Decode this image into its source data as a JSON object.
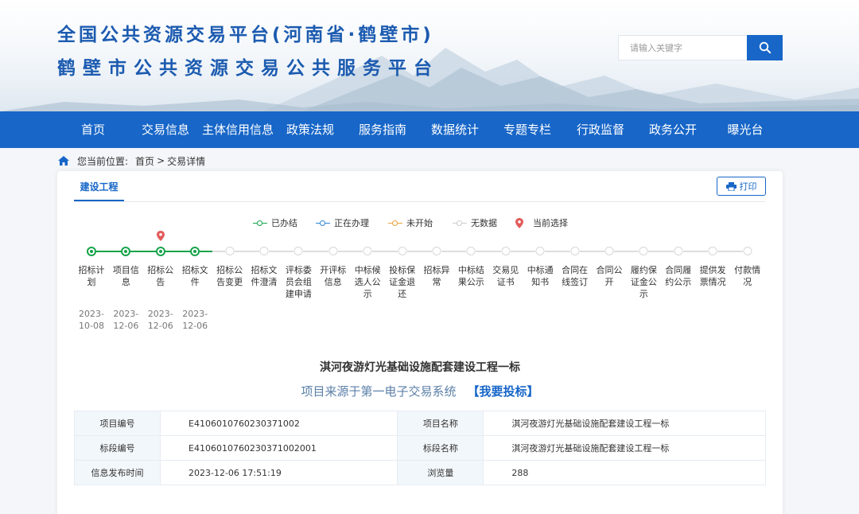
{
  "header": {
    "title_line1": "全国公共资源交易平台(河南省·鹤壁市)",
    "title_line2": "鹤壁市公共资源交易公共服务平台",
    "search_placeholder": "请输入关键字",
    "search_icon": "search-icon"
  },
  "nav": {
    "items": [
      "首页",
      "交易信息",
      "主体信用信息",
      "政策法规",
      "服务指南",
      "数据统计",
      "专题专栏",
      "行政监督",
      "政务公开",
      "曝光台"
    ]
  },
  "breadcrumb": {
    "icon": "home-icon",
    "label": "您当前位置:",
    "home": "首页",
    "separator": ">",
    "current": "交易详情"
  },
  "tabs": {
    "active": "建设工程"
  },
  "print_label": "打印",
  "legend": {
    "done": "已办结",
    "in_progress": "正在办理",
    "not_started": "未开始",
    "no_data": "无数据",
    "current": "当前选择",
    "colors": {
      "done": "#16a34a",
      "in_progress": "#2f86d6",
      "not_started": "#e8a33a",
      "no_data": "#cccccc",
      "current": "#e25b5b"
    }
  },
  "timeline": {
    "steps": [
      {
        "label": "招标计划",
        "date": "2023-10-08",
        "status": "done"
      },
      {
        "label": "项目信息",
        "date": "2023-12-06",
        "status": "done"
      },
      {
        "label": "招标公告",
        "date": "2023-12-06",
        "status": "done",
        "current": true
      },
      {
        "label": "招标文件",
        "date": "2023-12-06",
        "status": "done"
      },
      {
        "label": "招标公告变更",
        "date": "",
        "status": "none"
      },
      {
        "label": "招标文件澄清",
        "date": "",
        "status": "none"
      },
      {
        "label": "评标委员会组建申请",
        "date": "",
        "status": "none"
      },
      {
        "label": "开评标信息",
        "date": "",
        "status": "none"
      },
      {
        "label": "中标候选人公示",
        "date": "",
        "status": "none"
      },
      {
        "label": "投标保证金退还",
        "date": "",
        "status": "none"
      },
      {
        "label": "招标异常",
        "date": "",
        "status": "none"
      },
      {
        "label": "中标结果公示",
        "date": "",
        "status": "none"
      },
      {
        "label": "交易见证书",
        "date": "",
        "status": "none"
      },
      {
        "label": "中标通知书",
        "date": "",
        "status": "none"
      },
      {
        "label": "合同在线签订",
        "date": "",
        "status": "none"
      },
      {
        "label": "合同公开",
        "date": "",
        "status": "none"
      },
      {
        "label": "履约保证金公示",
        "date": "",
        "status": "none"
      },
      {
        "label": "合同履约公示",
        "date": "",
        "status": "none"
      },
      {
        "label": "提供发票情况",
        "date": "",
        "status": "none"
      },
      {
        "label": "付款情况",
        "date": "",
        "status": "none"
      }
    ]
  },
  "project": {
    "title": "淇河夜游灯光基础设施配套建设工程一标",
    "source_text": "项目来源于第一电子交易系统",
    "bid_link": "【我要投标】"
  },
  "info_table": {
    "rows": [
      {
        "k1": "项目编号",
        "v1": "E4106010760230371002",
        "k2": "项目名称",
        "v2": "淇河夜游灯光基础设施配套建设工程一标"
      },
      {
        "k1": "标段编号",
        "v1": "E4106010760230371002001",
        "k2": "标段名称",
        "v2": "淇河夜游灯光基础设施配套建设工程一标"
      },
      {
        "k1": "信息发布时间",
        "v1": "2023-12-06 17:51:19",
        "k2": "浏览量",
        "v2": "288"
      }
    ]
  }
}
